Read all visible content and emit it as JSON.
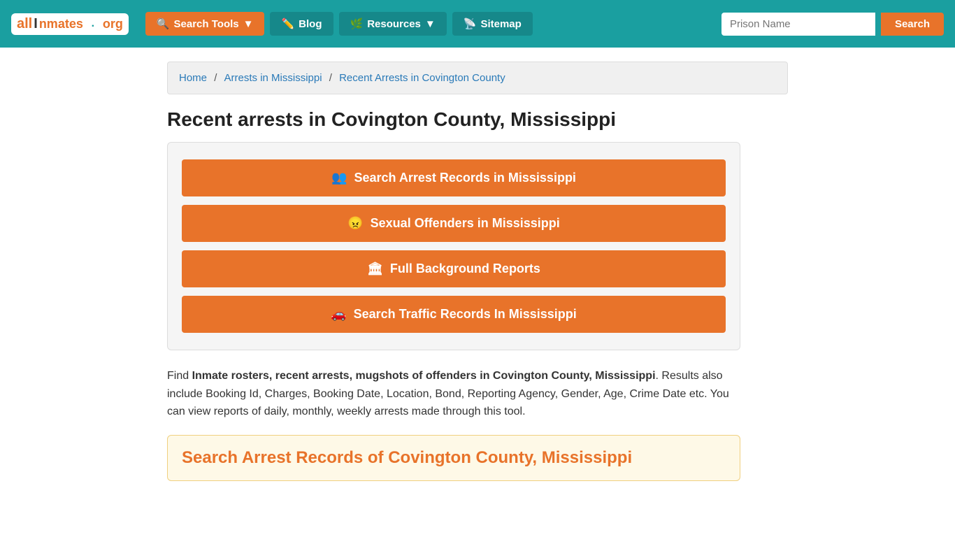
{
  "navbar": {
    "logo": {
      "all": "all",
      "inmates": "Inmates",
      "org": ".org"
    },
    "search_tools_label": "Search Tools",
    "blog_label": "Blog",
    "resources_label": "Resources",
    "sitemap_label": "Sitemap",
    "search_input_placeholder": "Prison Name",
    "search_button_label": "Search"
  },
  "breadcrumb": {
    "home": "Home",
    "arrests": "Arrests in Mississippi",
    "current": "Recent Arrests in Covington County"
  },
  "page": {
    "title": "Recent arrests in Covington County, Mississippi",
    "card_buttons": [
      {
        "icon": "👥",
        "label": "Search Arrest Records in Mississippi"
      },
      {
        "icon": "😠",
        "label": "Sexual Offenders in Mississippi"
      },
      {
        "icon": "🏛",
        "label": "Full Background Reports"
      },
      {
        "icon": "🚗",
        "label": "Search Traffic Records In Mississippi"
      }
    ],
    "description_intro": "Find ",
    "description_bold": "Inmate rosters, recent arrests, mugshots of offenders in Covington County, Mississippi",
    "description_rest": ". Results also include Booking Id, Charges, Booking Date, Location, Bond, Reporting Agency, Gender, Age, Crime Date etc. You can view reports of daily, monthly, weekly arrests made through this tool.",
    "search_section_title": "Search Arrest Records of Covington County, Mississippi"
  }
}
